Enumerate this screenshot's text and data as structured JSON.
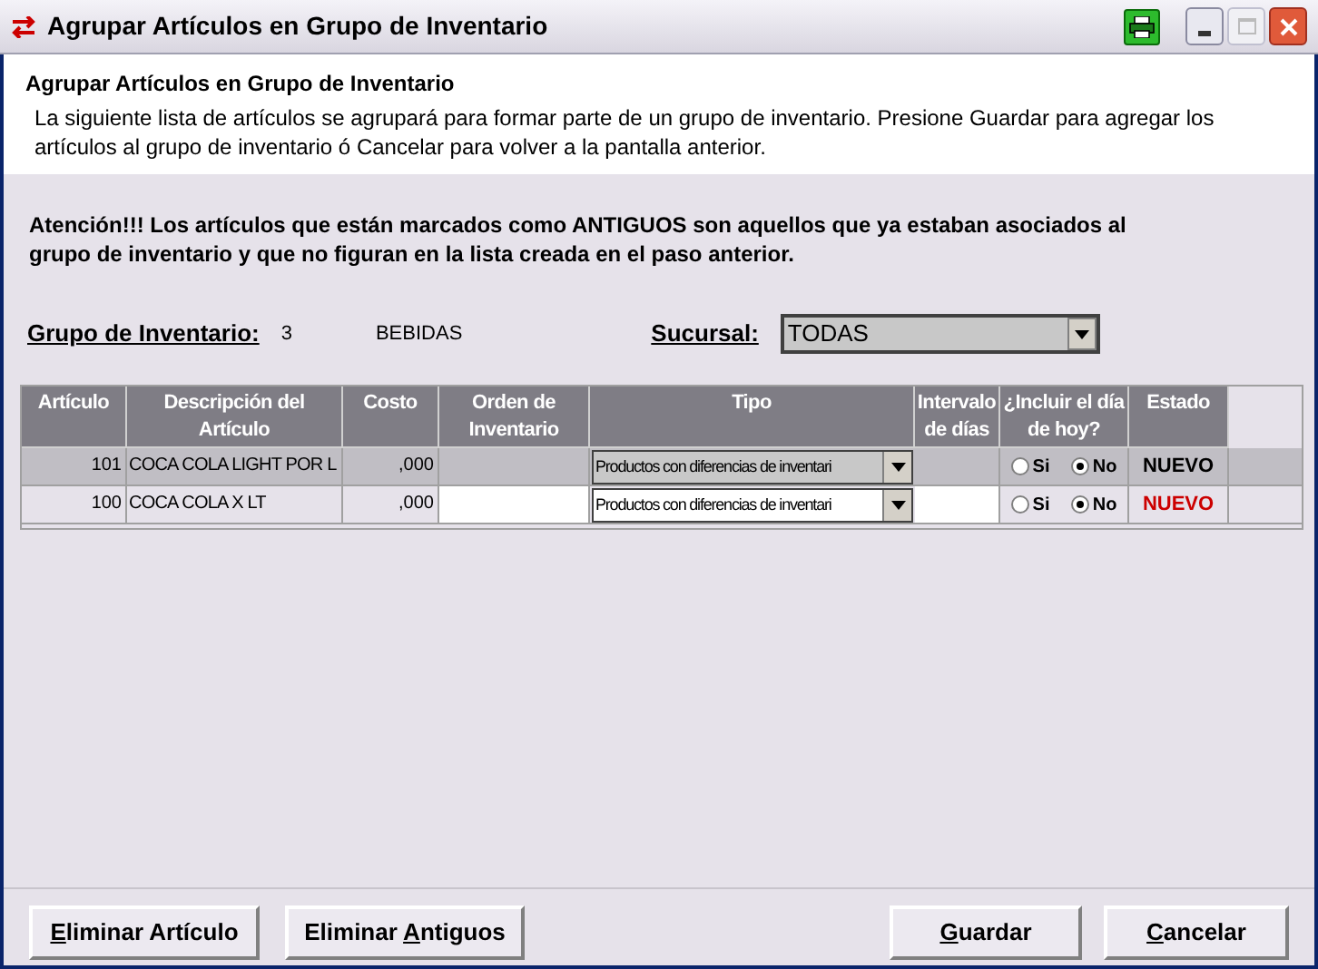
{
  "window": {
    "title": "Agrupar Artículos en Grupo de Inventario"
  },
  "header": {
    "title": "Agrupar Artículos en Grupo de Inventario",
    "description": "La siguiente lista de artículos se agrupará para formar parte de un grupo de inventario. Presione Guardar para agregar los artículos al grupo de inventario ó Cancelar para volver a la pantalla anterior."
  },
  "notice": "Atención!!! Los artículos que están marcados como ANTIGUOS son aquellos que ya estaban asociados al grupo de inventario y que no figuran en la lista creada en el paso anterior.",
  "group": {
    "label": "Grupo de Inventario:",
    "code": "3",
    "name": "BEBIDAS"
  },
  "branch": {
    "label": "Sucursal:",
    "value": "TODAS"
  },
  "table": {
    "columns": [
      "Artículo",
      "Descripción del Artículo",
      "Costo",
      "Orden de Inventario",
      "Tipo",
      "Intervalo de días",
      "¿Incluir el día de hoy?",
      "Estado"
    ],
    "rows": [
      {
        "selected": true,
        "article": "101",
        "description": "COCA COLA LIGHT POR L",
        "cost": ",000",
        "type": "Productos con diferencias de inventari",
        "options": [
          {
            "label": "Si",
            "selected": false
          },
          {
            "label": "No",
            "selected": true
          }
        ],
        "status": "NUEVO",
        "color": "#000000"
      },
      {
        "selected": false,
        "article": "100",
        "description": "COCA COLA X LT",
        "cost": ",000",
        "type": "Productos con diferencias de inventari",
        "options": [
          {
            "label": "Si",
            "selected": false
          },
          {
            "label": "No",
            "selected": true
          }
        ],
        "status": "NUEVO",
        "color": "#cc0000"
      }
    ]
  },
  "left_buttons": [
    {
      "key": "E",
      "after": "liminar Artículo"
    },
    {
      "before": "Eliminar ",
      "key": "A",
      "after": "ntiguos"
    }
  ],
  "right_buttons": [
    {
      "key": "G",
      "after": "uardar"
    },
    {
      "key": "C",
      "after": "ancelar"
    }
  ]
}
